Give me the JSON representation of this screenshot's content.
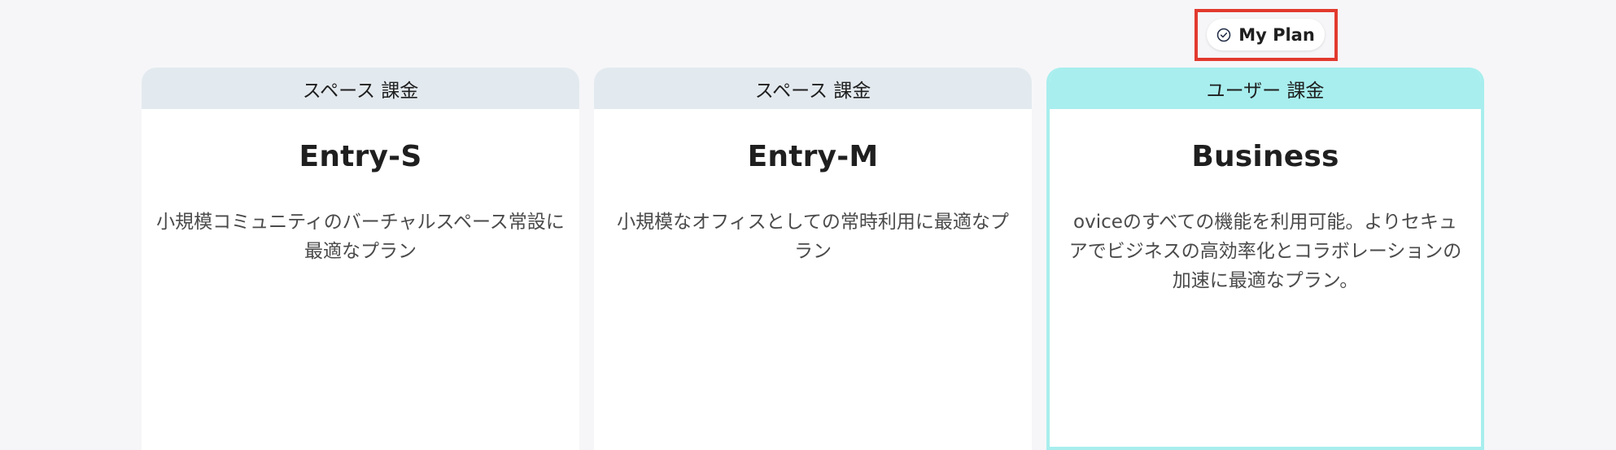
{
  "my_plan": {
    "label": "My Plan",
    "icon": "check-circle-icon"
  },
  "plans": [
    {
      "billing_type": "スペース 課金",
      "name": "Entry-S",
      "description": "小規模コミュニティのバーチャルスペース常設に最適なプラン",
      "header_color": "#e3eaef",
      "current": false
    },
    {
      "billing_type": "スペース 課金",
      "name": "Entry-M",
      "description": "小規模なオフィスとしての常時利用に最適なプラン",
      "header_color": "#e3eaef",
      "current": false
    },
    {
      "billing_type": "ユーザー 課金",
      "name": "Business",
      "description": "oviceのすべての機能を利用可能。よりセキュアでビジネスの高効率化とコラボレーションの加速に最適なプラン。",
      "header_color": "#a8eeee",
      "current": true
    }
  ],
  "colors": {
    "background": "#f6f6f8",
    "highlight_border": "#e23a2e",
    "current_plan_accent": "#a8eeee",
    "default_header": "#e3eaef"
  }
}
